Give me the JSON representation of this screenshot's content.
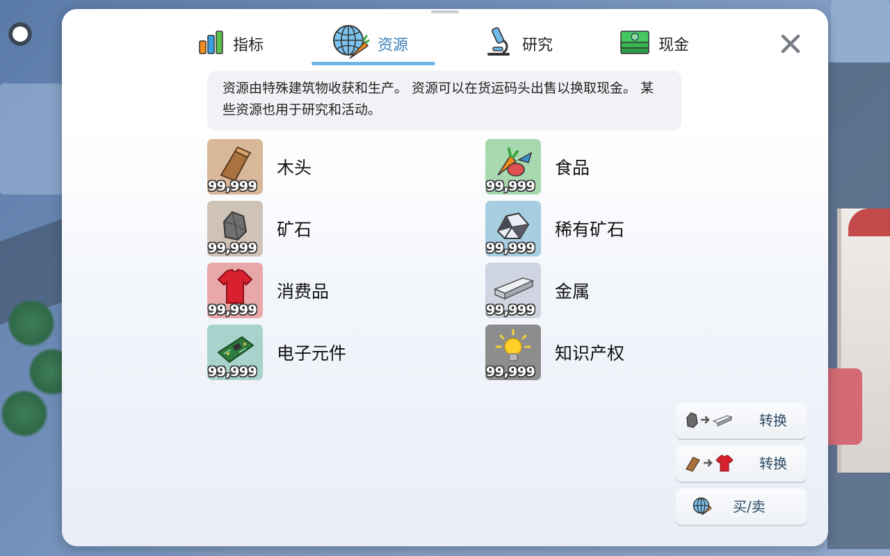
{
  "tabs": [
    {
      "label": "指标",
      "icon": "bar-chart-icon",
      "active": false
    },
    {
      "label": "资源",
      "icon": "globe-carrot-icon",
      "active": true
    },
    {
      "label": "研究",
      "icon": "microscope-icon",
      "active": false
    },
    {
      "label": "现金",
      "icon": "cash-icon",
      "active": false
    }
  ],
  "description": "资源由特殊建筑物收获和生产。 资源可以在货运码头出售以换取现金。 某些资源也用于研究和活动。",
  "resources": [
    {
      "name": "木头",
      "count": "99,999",
      "icon": "wood-icon",
      "bg": "#d9b89a"
    },
    {
      "name": "食品",
      "count": "99,999",
      "icon": "food-icon",
      "bg": "#a8d8b0"
    },
    {
      "name": "矿石",
      "count": "99,999",
      "icon": "ore-icon",
      "bg": "#cfc3b8"
    },
    {
      "name": "稀有矿石",
      "count": "99,999",
      "icon": "rare-ore-icon",
      "bg": "#a6cde0"
    },
    {
      "name": "消费品",
      "count": "99,999",
      "icon": "tshirt-icon",
      "bg": "#e8a8aa"
    },
    {
      "name": "金属",
      "count": "99,999",
      "icon": "metal-beam-icon",
      "bg": "#cfd5e0"
    },
    {
      "name": "电子元件",
      "count": "99,999",
      "icon": "circuit-board-icon",
      "bg": "#a8d3cc"
    },
    {
      "name": "知识产权",
      "count": "99,999",
      "icon": "lightbulb-icon",
      "bg": "#8d8d8d"
    }
  ],
  "actions": [
    {
      "label": "转换",
      "from_icon": "ore-icon",
      "to_icon": "metal-beam-icon"
    },
    {
      "label": "转换",
      "from_icon": "wood-icon",
      "to_icon": "tshirt-icon"
    },
    {
      "label": "买/卖",
      "icon": "globe-carrot-icon"
    }
  ]
}
